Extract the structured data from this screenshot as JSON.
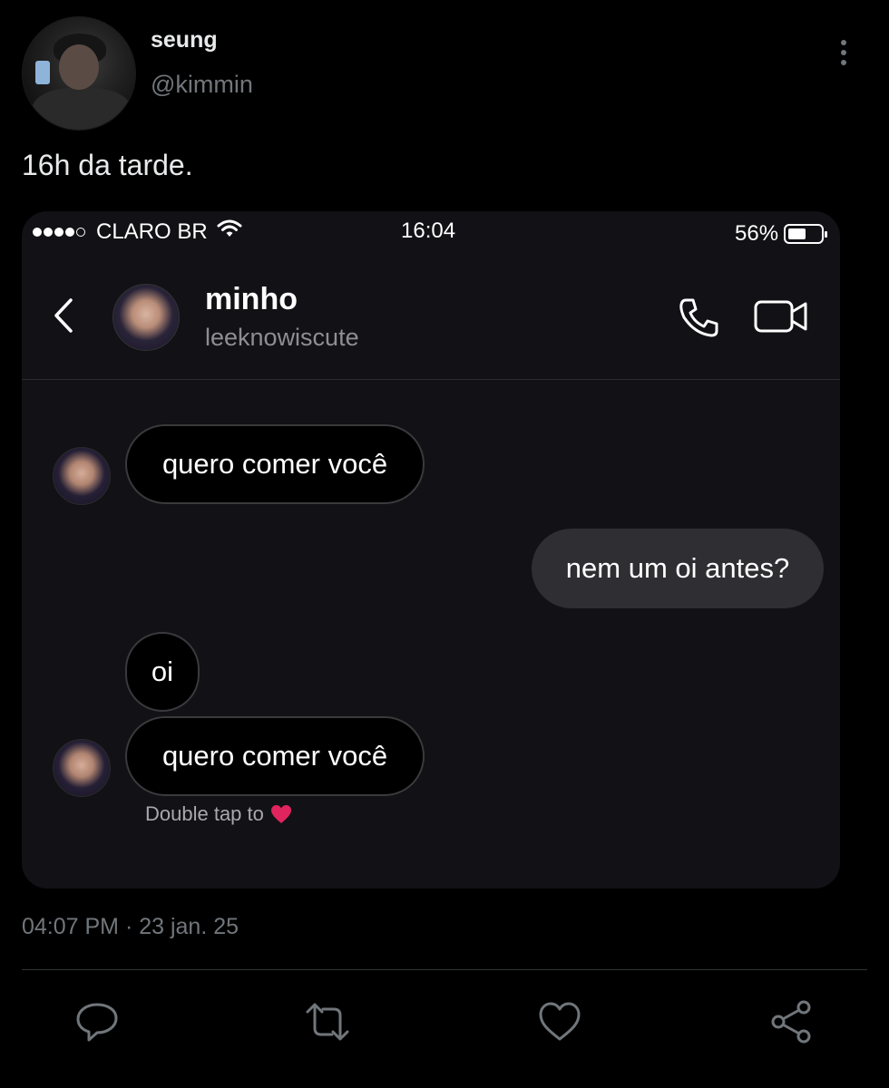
{
  "tweet": {
    "author_name": "seung",
    "author_handle": "@kimmin",
    "text": "16h da tarde.",
    "timestamp": "04:07 PM · 23 jan. 25"
  },
  "dm_screenshot": {
    "status_bar": {
      "carrier": "CLARO BR",
      "time": "16:04",
      "battery": "56%",
      "battery_level": 0.56
    },
    "contact": {
      "name": "minho",
      "username": "leeknowiscute"
    },
    "messages": [
      {
        "side": "incoming",
        "text": "quero comer você"
      },
      {
        "side": "outgoing",
        "text": "nem um oi antes?"
      },
      {
        "side": "incoming",
        "text": "oi"
      },
      {
        "side": "incoming",
        "text": "quero comer você"
      }
    ],
    "reaction_hint": "Double tap to"
  },
  "icons": {
    "more": "more-vertical-icon",
    "back": "chevron-left-icon",
    "call": "phone-icon",
    "video": "video-camera-icon",
    "heart_hint": "red-heart-icon",
    "reply": "reply-icon",
    "retweet": "retweet-icon",
    "like": "like-heart-icon",
    "share": "share-icon"
  },
  "colors": {
    "background": "#000000",
    "dm_background": "#111116",
    "outgoing_bubble": "#2e2e33",
    "incoming_bubble": "#000000",
    "muted_text": "#71767b",
    "heart": "#e0245e"
  }
}
